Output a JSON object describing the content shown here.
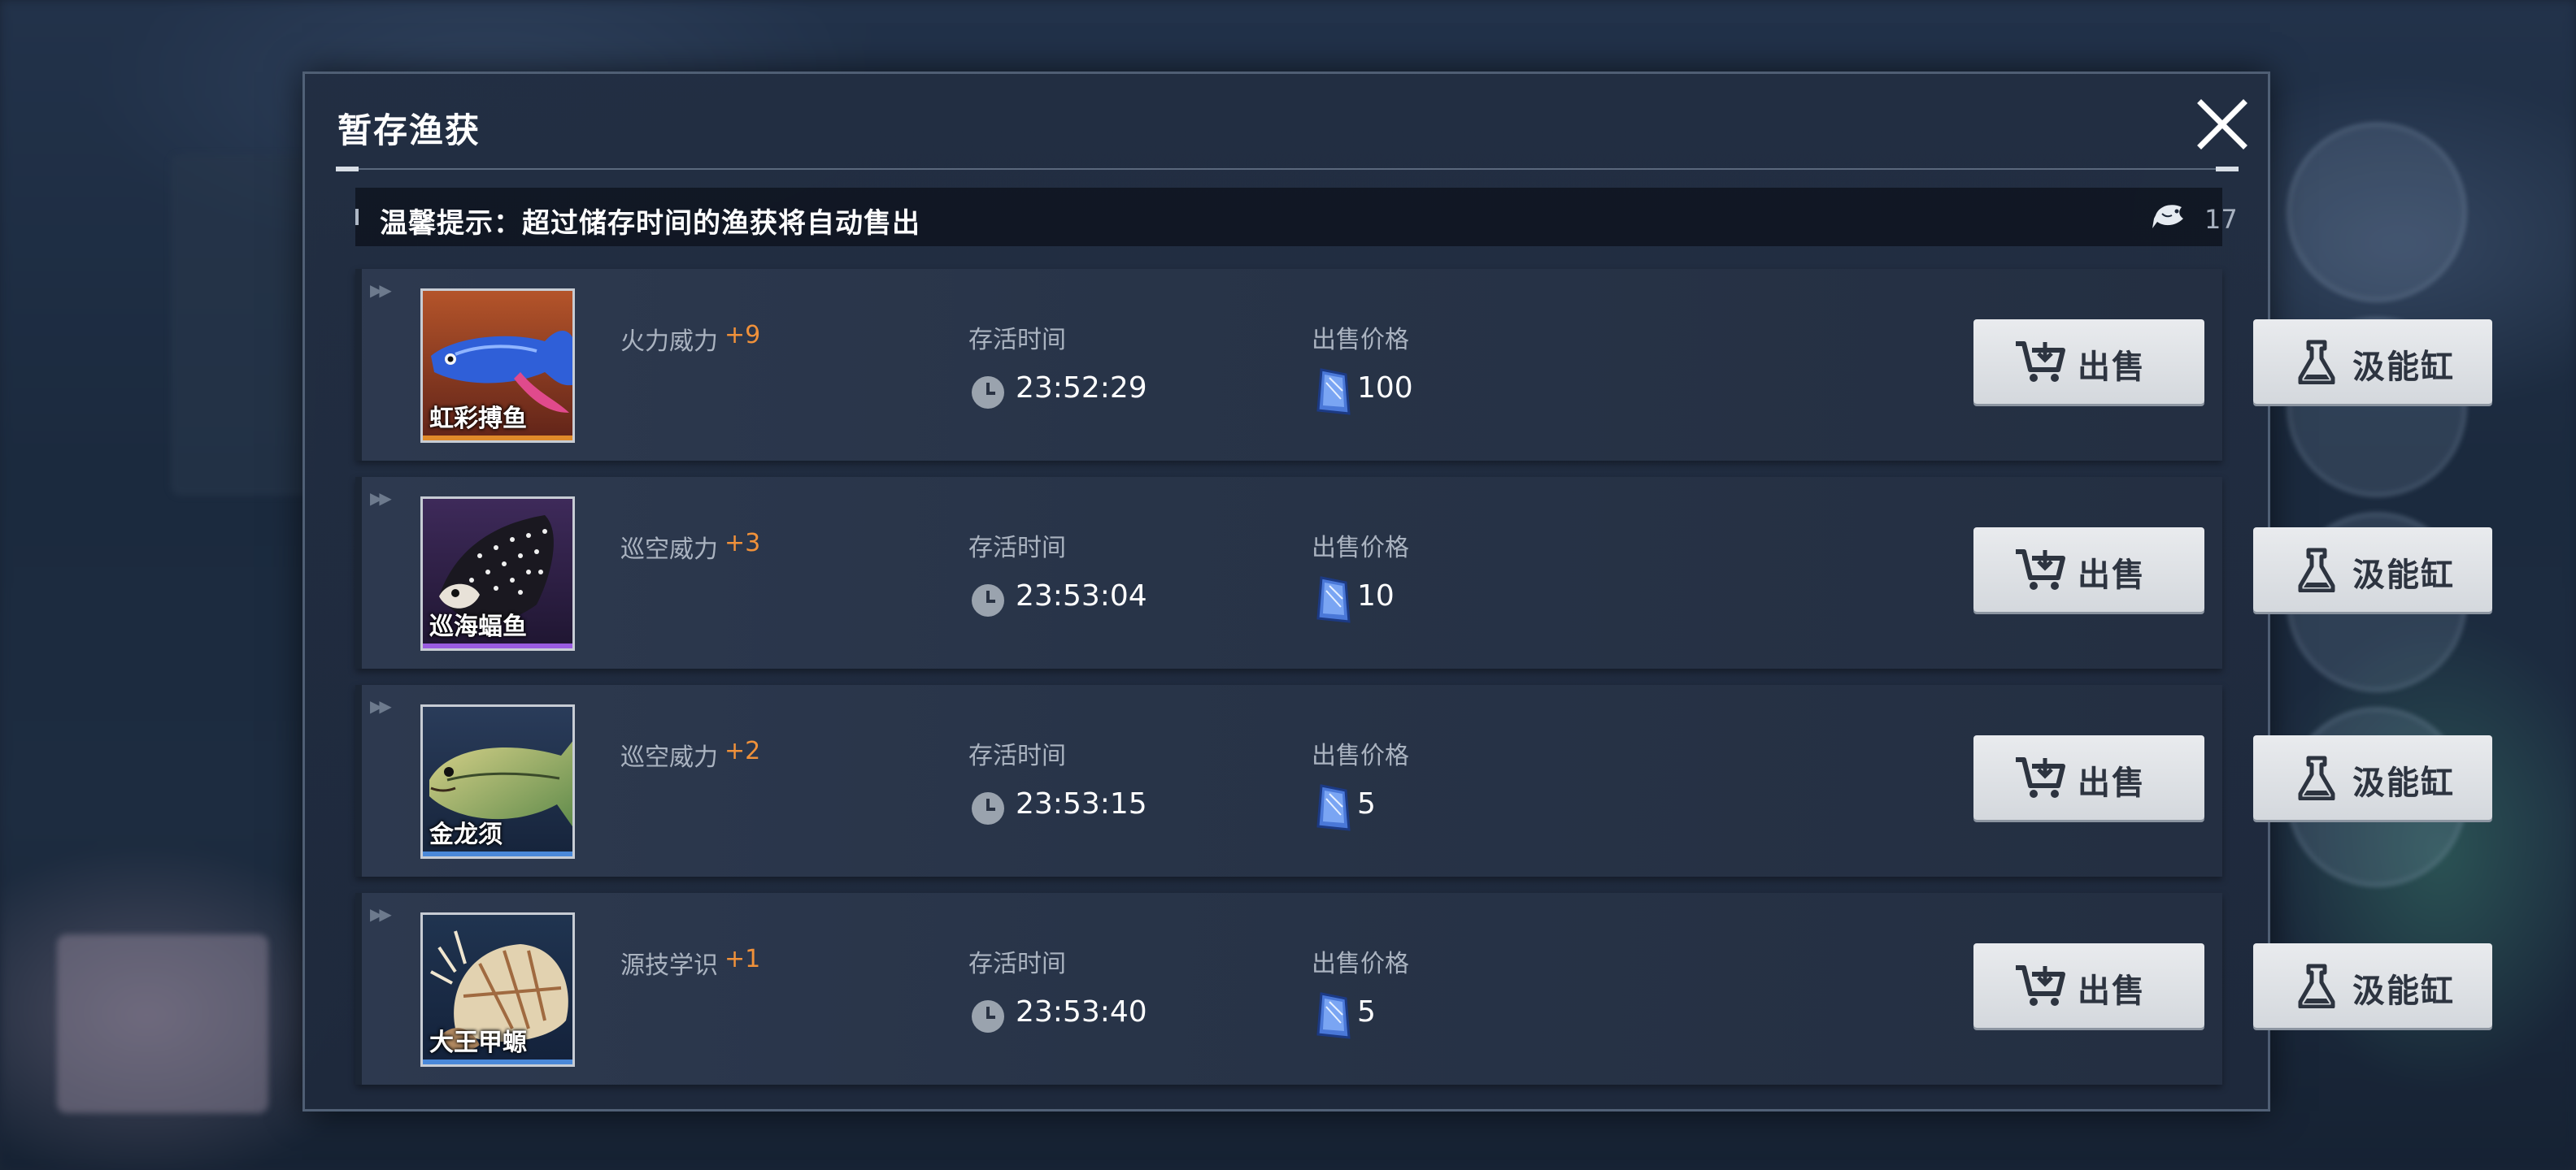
{
  "dialog": {
    "title": "暂存渔获",
    "tip": "温馨提示：超过储存时间的渔获将自动售出",
    "count": "17"
  },
  "columns": {
    "time_label": "存活时间",
    "price_label": "出售价格"
  },
  "buttons": {
    "sell_label": "出售",
    "absorb_label": "汲能缸"
  },
  "colors": {
    "bonus": "#f0913a",
    "rarity_orange": "#e08a2a",
    "rarity_purple": "#9a5ce0",
    "rarity_blue": "#4a88d8"
  },
  "fish": [
    {
      "name": "虹彩搏鱼",
      "attr": "火力威力",
      "bonus": "+9",
      "time": "23:52:29",
      "price": "100",
      "rarity": "orange"
    },
    {
      "name": "巡海蝠鱼",
      "attr": "巡空威力",
      "bonus": "+3",
      "time": "23:53:04",
      "price": "10",
      "rarity": "purple"
    },
    {
      "name": "金龙须",
      "attr": "巡空威力",
      "bonus": "+2",
      "time": "23:53:15",
      "price": "5",
      "rarity": "blue"
    },
    {
      "name": "大王甲螈",
      "attr": "源技学识",
      "bonus": "+1",
      "time": "23:53:40",
      "price": "5",
      "rarity": "blue"
    }
  ]
}
